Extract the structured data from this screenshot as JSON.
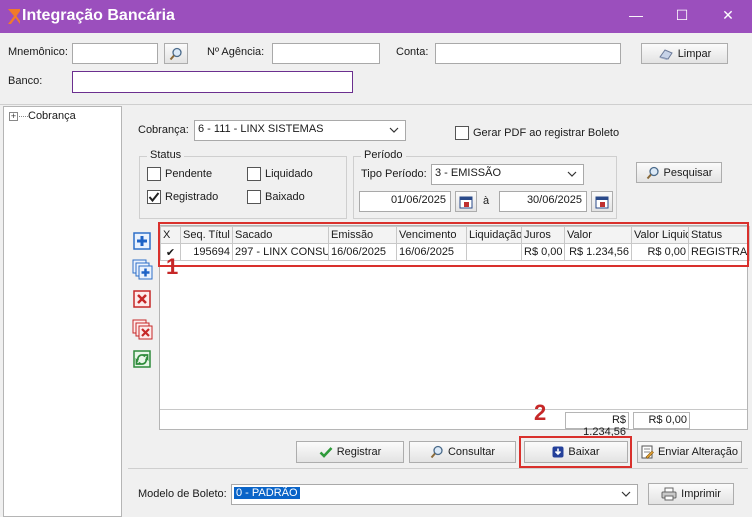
{
  "window": {
    "title": "Integração Bancária",
    "minimize": "—",
    "maximize": "☐",
    "close": "✕"
  },
  "header": {
    "mnemonico_label": "Mnemônico:",
    "agencia_label": "Nº Agência:",
    "conta_label": "Conta:",
    "banco_label": "Banco:",
    "limpar_label": "Limpar"
  },
  "tree": {
    "root_label": "Cobrança",
    "expander": "+"
  },
  "filters": {
    "cobranca_label": "Cobrança:",
    "cobranca_value": "6 - 111 - LINX SISTEMAS",
    "gerar_pdf_label": "Gerar PDF ao registrar Boleto",
    "status_title": "Status",
    "pendente_label": "Pendente",
    "liquidado_label": "Liquidado",
    "registrado_label": "Registrado",
    "baixado_label": "Baixado",
    "periodo_title": "Período",
    "tipo_periodo_label": "Tipo Período:",
    "tipo_periodo_value": "3 - EMISSÃO",
    "date_from": "01/06/2025",
    "date_sep": "à",
    "date_to": "30/06/2025",
    "pesquisar_label": "Pesquisar"
  },
  "grid": {
    "columns": [
      "X",
      "Seq. Títul",
      "Sacado",
      "Emissão",
      "Vencimento",
      "Liquidação",
      "Juros",
      "Valor",
      "Valor Liquic",
      "Status"
    ],
    "rows": [
      {
        "check": "✔",
        "seq": "195694",
        "sacado": "297 - LINX CONSUL",
        "emissao": "16/06/2025",
        "vencimento": "16/06/2025",
        "liquidacao": "",
        "juros": "R$ 0,00",
        "valor": "R$ 1.234,56",
        "valor_liq": "R$ 0,00",
        "status": "REGISTRAD"
      }
    ],
    "total_valor": "R$ 1.234,56",
    "total_liq": "R$ 0,00"
  },
  "annotations": {
    "marker1": "1",
    "marker2": "2"
  },
  "actions": {
    "registrar": "Registrar",
    "consultar": "Consultar",
    "baixar": "Baixar",
    "enviar": "Enviar Alteração"
  },
  "footer": {
    "modelo_label": "Modelo de Boleto:",
    "modelo_value": "0 - PADRÃO",
    "imprimir_label": "Imprimir"
  },
  "colors": {
    "titlebar": "#9b4fbd",
    "accent_red": "#d9302c",
    "selection": "#0a64c8"
  }
}
